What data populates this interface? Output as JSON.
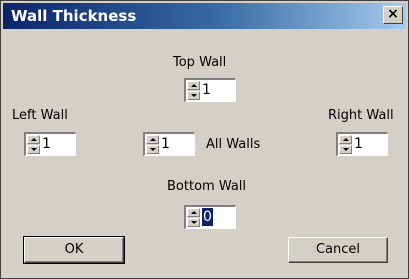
{
  "window": {
    "title": "Wall Thickness",
    "close_symbol": "×"
  },
  "fields": {
    "top_wall": {
      "label": "Top Wall",
      "value": "1"
    },
    "left_wall": {
      "label": "Left Wall",
      "value": "1"
    },
    "all_walls": {
      "label": "All Walls",
      "value": "1"
    },
    "right_wall": {
      "label": "Right Wall",
      "value": "1"
    },
    "bottom_wall": {
      "label": "Bottom Wall",
      "value": "0"
    }
  },
  "buttons": {
    "ok": "OK",
    "cancel": "Cancel"
  },
  "colors": {
    "title_start": "#0a246a",
    "title_end": "#a6caf0",
    "dialog_bg": "#d4d0c8",
    "selection": "#0a246a"
  },
  "icons": {
    "close": "close-icon",
    "spin_up": "spin-up-arrow-icon",
    "spin_down": "spin-down-arrow-icon"
  }
}
